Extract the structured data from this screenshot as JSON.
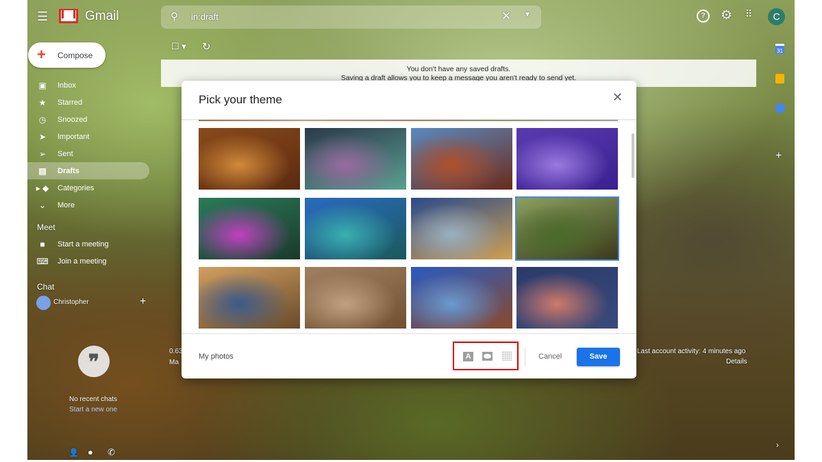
{
  "header": {
    "app_name": "Gmail",
    "search_value": "in:draft",
    "avatar_letter": "C",
    "icons": [
      "menu-icon",
      "gmail-logo",
      "search-icon",
      "clear-icon",
      "search-options-icon",
      "help-icon",
      "settings-icon",
      "apps-icon"
    ]
  },
  "compose": {
    "label": "Compose"
  },
  "sidebar": {
    "items": [
      {
        "label": "Inbox",
        "icon": "inbox-icon"
      },
      {
        "label": "Starred",
        "icon": "star-icon"
      },
      {
        "label": "Snoozed",
        "icon": "clock-icon"
      },
      {
        "label": "Important",
        "icon": "important-icon"
      },
      {
        "label": "Sent",
        "icon": "send-icon"
      },
      {
        "label": "Drafts",
        "icon": "draft-icon",
        "selected": true
      },
      {
        "label": "Categories",
        "icon": "label-icon"
      },
      {
        "label": "More",
        "icon": "chevron-down-icon"
      }
    ],
    "meet_heading": "Meet",
    "meet_items": [
      {
        "label": "Start a meeting"
      },
      {
        "label": "Join a meeting"
      }
    ],
    "chat_heading": "Chat",
    "chat_user": "Christopher",
    "no_chats": "No recent chats",
    "start_new": "Start a new one"
  },
  "banner": {
    "line1": "You don't have any saved drafts.",
    "line2": "Saving a draft allows you to keep a message you aren't ready to send yet."
  },
  "footer": {
    "storage": "0.63",
    "manage": "Ma",
    "activity": "Last account activity: 4 minutes ago",
    "details": "Details"
  },
  "side_panel": {
    "calendar_day": "31"
  },
  "dialog": {
    "title": "Pick your theme",
    "my_photos": "My photos",
    "cancel": "Cancel",
    "save": "Save",
    "tool_icons": [
      "text-background-icon",
      "vignette-icon",
      "blur-icon"
    ],
    "themes": [
      {
        "name": "autumn-leaves",
        "colors": [
          "#8a4a1a",
          "#d08a3a",
          "#5a2a10"
        ]
      },
      {
        "name": "bokeh-lights",
        "colors": [
          "#2a3a4a",
          "#9a6aa0",
          "#5aa090"
        ]
      },
      {
        "name": "canyon",
        "colors": [
          "#5a8ac0",
          "#b0502a",
          "#6a2a1a"
        ]
      },
      {
        "name": "jellyfish",
        "colors": [
          "#5a3ab0",
          "#9a7ae0",
          "#3a2090"
        ]
      },
      {
        "name": "rainbow-water",
        "colors": [
          "#2a7a5a",
          "#c040c0",
          "#1a3a2a"
        ]
      },
      {
        "name": "lake-tahoe",
        "colors": [
          "#2a6ac0",
          "#3ab0b0",
          "#1a5a5a"
        ]
      },
      {
        "name": "beach",
        "colors": [
          "#2a4a8a",
          "#9ab0c0",
          "#d0a050"
        ]
      },
      {
        "name": "forest",
        "colors": [
          "#8aa060",
          "#4a6a2a",
          "#3a3a1a"
        ],
        "selected": true
      },
      {
        "name": "golden-gate",
        "colors": [
          "#d0a060",
          "#3a5a8a",
          "#6a4a2a"
        ]
      },
      {
        "name": "desert-rock",
        "colors": [
          "#a08060",
          "#c0a080",
          "#705030"
        ]
      },
      {
        "name": "skyscrapers",
        "colors": [
          "#2a5ac0",
          "#6a9ad0",
          "#8a4a2a"
        ]
      },
      {
        "name": "storm-sky",
        "colors": [
          "#2a3a6a",
          "#d07a6a",
          "#3a4a7a"
        ]
      }
    ]
  }
}
